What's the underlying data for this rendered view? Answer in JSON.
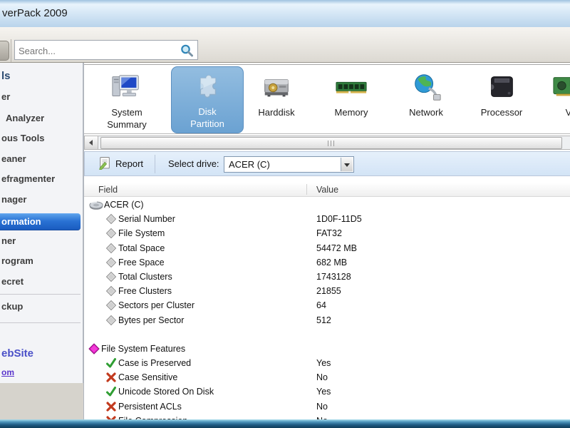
{
  "window": {
    "title": "verPack 2009"
  },
  "search": {
    "placeholder": "Search..."
  },
  "sidebar": {
    "items": [
      {
        "label": "ls",
        "type": "header"
      },
      {
        "label": "er"
      },
      {
        "label": "Analyzer"
      },
      {
        "label": "ous Tools"
      },
      {
        "label": "eaner"
      },
      {
        "label": "efragmenter"
      },
      {
        "label": "nager"
      },
      {
        "label": "ormation",
        "selected": true
      },
      {
        "label": "ner"
      },
      {
        "label": "rogram"
      },
      {
        "label": "ecret"
      },
      {
        "label": "ckup"
      },
      {
        "label": "ebSite",
        "type": "header2"
      },
      {
        "label": "om",
        "type": "link"
      }
    ]
  },
  "categories": [
    {
      "label": "System Summary",
      "icon": "computer",
      "two_line": true
    },
    {
      "label": "Disk Partition",
      "icon": "partition",
      "two_line": true,
      "selected": true
    },
    {
      "label": "Harddisk",
      "icon": "harddisk"
    },
    {
      "label": "Memory",
      "icon": "memory"
    },
    {
      "label": "Network",
      "icon": "network"
    },
    {
      "label": "Processor",
      "icon": "processor"
    },
    {
      "label": "V",
      "icon": "video"
    }
  ],
  "toolbar": {
    "report": "Report",
    "select_drive": "Select drive:",
    "drive": "ACER (C)"
  },
  "table": {
    "columns": [
      "Field",
      "Value"
    ],
    "rows": [
      {
        "icon": "disk",
        "indent": 0,
        "field": "ACER (C)",
        "value": ""
      },
      {
        "icon": "diamond",
        "indent": 1,
        "field": "Serial Number",
        "value": "1D0F-11D5"
      },
      {
        "icon": "diamond",
        "indent": 1,
        "field": "File System",
        "value": "FAT32"
      },
      {
        "icon": "diamond",
        "indent": 1,
        "field": "Total Space",
        "value": "54472 MB"
      },
      {
        "icon": "diamond",
        "indent": 1,
        "field": "Free Space",
        "value": "682 MB"
      },
      {
        "icon": "diamond",
        "indent": 1,
        "field": "Total Clusters",
        "value": "1743128"
      },
      {
        "icon": "diamond",
        "indent": 1,
        "field": "Free Clusters",
        "value": "21855"
      },
      {
        "icon": "diamond",
        "indent": 1,
        "field": "Sectors per Cluster",
        "value": "64"
      },
      {
        "icon": "diamond",
        "indent": 1,
        "field": "Bytes per Sector",
        "value": "512"
      },
      {
        "icon": "none",
        "indent": 0,
        "field": "",
        "value": ""
      },
      {
        "icon": "diamondMagenta",
        "indent": 0,
        "field": "File System Features",
        "value": ""
      },
      {
        "icon": "check",
        "indent": 1,
        "field": "Case is Preserved",
        "value": "Yes"
      },
      {
        "icon": "cross",
        "indent": 1,
        "field": "Case Sensitive",
        "value": "No"
      },
      {
        "icon": "check",
        "indent": 1,
        "field": "Unicode Stored On Disk",
        "value": "Yes"
      },
      {
        "icon": "cross",
        "indent": 1,
        "field": "Persistent ACLs",
        "value": "No"
      },
      {
        "icon": "cross",
        "indent": 1,
        "field": "File Compression",
        "value": "No"
      }
    ]
  },
  "colors": {
    "selected_nav_blue": "#2a72d4",
    "selected_tile_blue": "#79a9d4",
    "section_diamond_magenta": "#e31cc4",
    "yes_check_green": "#2f9e33",
    "no_cross_red": "#c23a1e",
    "link_purple": "#5a35cc",
    "titlebar_blue": "#cfe3f4"
  }
}
